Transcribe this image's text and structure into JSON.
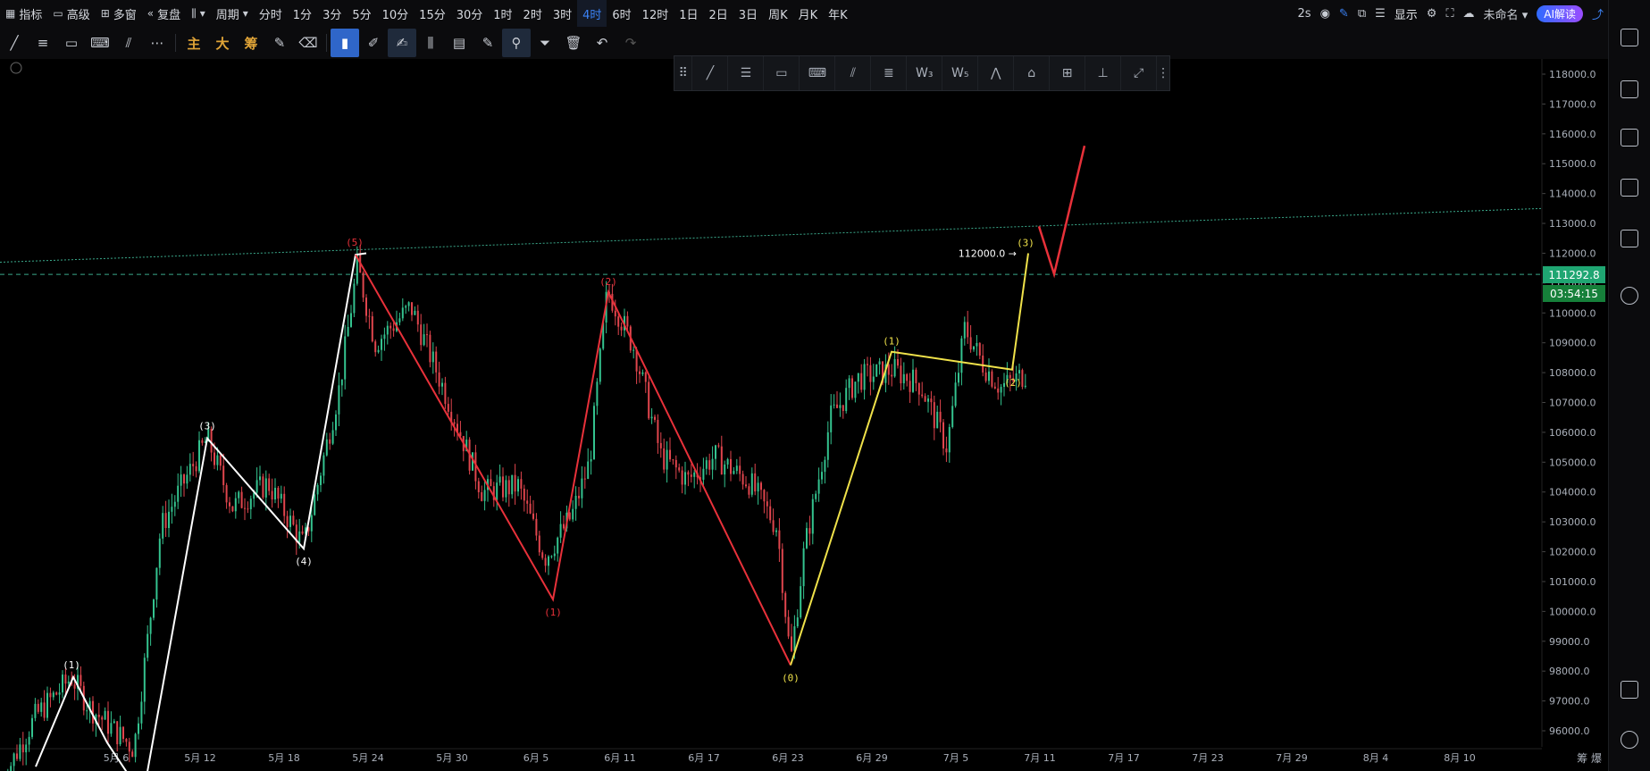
{
  "topbar": {
    "indicators": "指标",
    "advanced": "高级",
    "multi_window": "多窗",
    "replay": "复盘",
    "period": "周期",
    "timeframes": [
      "分时",
      "1分",
      "3分",
      "5分",
      "10分",
      "15分",
      "30分",
      "1时",
      "2时",
      "3时",
      "4时",
      "6时",
      "12时",
      "1日",
      "2日",
      "3日",
      "周K",
      "月K",
      "年K"
    ],
    "active_timeframe": "4时",
    "refresh": "2s",
    "display": "显示",
    "unnamed": "未命名",
    "ai_button": "AI解读"
  },
  "toolbar": {
    "groups": [
      "主",
      "大",
      "筹"
    ]
  },
  "chart_data": {
    "type": "candlestick",
    "current_price": "111292.8",
    "countdown": "03:54:15",
    "annotation_price": "112000.0",
    "y_axis_ticks": [
      "118000.0",
      "117000.0",
      "116000.0",
      "115000.0",
      "114000.0",
      "113000.0",
      "112000.0",
      "111000.0",
      "110000.0",
      "109000.0",
      "108000.0",
      "107000.0",
      "106000.0",
      "105000.0",
      "104000.0",
      "103000.0",
      "102000.0",
      "101000.0",
      "100000.0",
      "99000.0",
      "98000.0",
      "97000.0",
      "96000.0"
    ],
    "x_axis_ticks": [
      "5月 6",
      "5月 12",
      "5月 18",
      "5月 24",
      "5月 30",
      "6月 5",
      "6月 11",
      "6月 17",
      "6月 23",
      "6月 29",
      "7月 5",
      "7月 11",
      "7月 17",
      "7月 23",
      "7月 29",
      "8月 4",
      "8月 10"
    ],
    "waves": {
      "white": [
        "(1)",
        "(3)",
        "(4)",
        "(5)"
      ],
      "red": [
        "(1)",
        "(2)"
      ],
      "yellow": [
        "(0)",
        "(1)",
        "(2)",
        "(3)"
      ]
    },
    "colors": {
      "up": "#34c38f",
      "down": "#e0454d",
      "white_wave": "#ffffff",
      "red_wave": "#e8313a",
      "yellow_wave": "#f0e24a",
      "trendline": "#3aa88a",
      "price_tag": "#1fa672"
    }
  },
  "corner": "筹 爆"
}
